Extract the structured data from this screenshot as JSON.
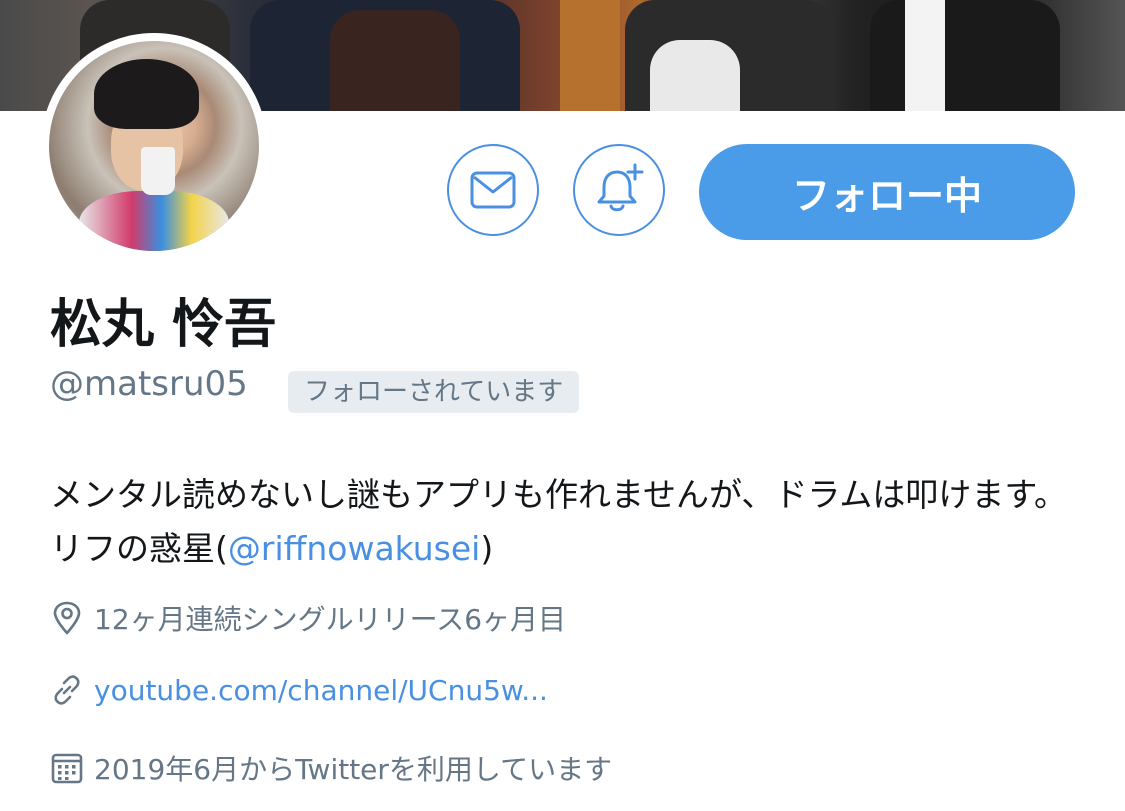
{
  "header": {
    "banner_label": "",
    "avatar_label": ""
  },
  "actions": {
    "message_icon": "mail-icon",
    "notify_icon": "bell-plus-icon",
    "follow_label": "フォロー中"
  },
  "profile": {
    "name": "松丸 怜吾",
    "handle": "@matsru05",
    "follows_you": "フォローされています",
    "bio_text": "メンタル読めないし謎もアプリも作れませんが、ドラムは叩けます。 リフの惑星(",
    "bio_mention": "@riffnowakusei",
    "bio_close": ")",
    "location": "12ヶ月連続シングルリリース6ヶ月目",
    "url": "youtube.com/channel/UCnu5w...",
    "joined": "2019年6月からTwitterを利用しています"
  },
  "colors": {
    "accent": "#4a90e2",
    "follow_fill": "#4a9be8",
    "muted": "#657786",
    "badge_bg": "#e6ecf0"
  }
}
